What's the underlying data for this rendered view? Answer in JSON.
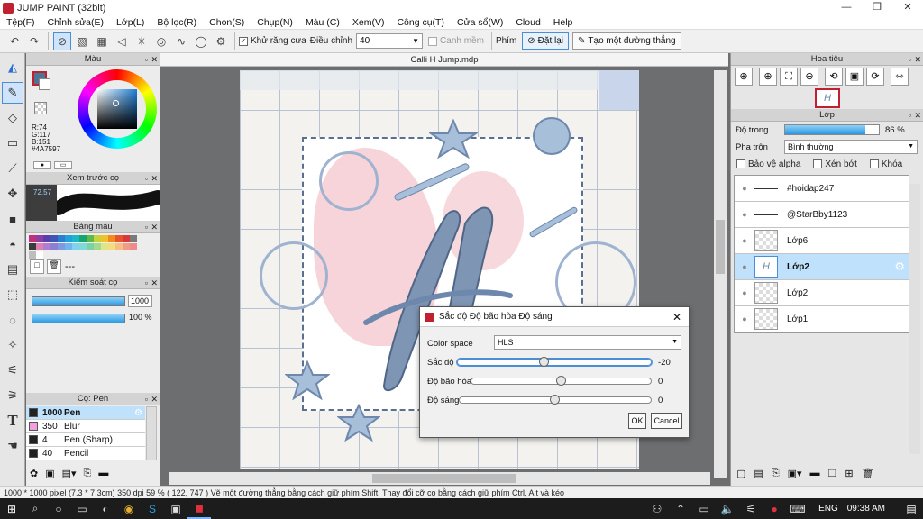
{
  "app": {
    "title": "JUMP PAINT (32bit)",
    "win_min": "—",
    "win_max": "❐",
    "win_close": "✕"
  },
  "menu": [
    "Tệp(F)",
    "Chỉnh sửa(E)",
    "Lớp(L)",
    "Bộ lọc(R)",
    "Chọn(S)",
    "Chụp(N)",
    "Màu (C)",
    "Xem(V)",
    "Công cụ(T)",
    "Cửa sổ(W)",
    "Cloud",
    "Help"
  ],
  "toolbar": {
    "antialias_label": "Khử răng cưa",
    "adjust_label": "Điều chỉnh",
    "adjust_value": "40",
    "snap_label": "Canh mềm",
    "key_label": "Phím",
    "reset_label": "Đặt lại",
    "line_label": "Tạo một đường thẳng"
  },
  "panels": {
    "color": {
      "title": "Màu",
      "r": "R:74",
      "g": "G:117",
      "b": "B:151",
      "hex": "#4A7597",
      "fg": "#4a7597"
    },
    "brush_preview": {
      "title": "Xem trước cọ",
      "pct": "72.57"
    },
    "palette": {
      "title": "Bảng màu",
      "more": "---",
      "swatches": [
        "#c0307c",
        "#8c3fa0",
        "#5b3fae",
        "#3f56b4",
        "#2b7fd1",
        "#22a0d8",
        "#1ab6c9",
        "#1aa36e",
        "#5fb84a",
        "#c6d23c",
        "#f0c22a",
        "#f08c1e",
        "#e8532b",
        "#d63a3a",
        "#7a7a7a",
        "#3b3b3b",
        "#e07fb4",
        "#b07dd0",
        "#8a80d6",
        "#7f9ae0",
        "#6fb6ee",
        "#7fd2f0",
        "#7fd9d6",
        "#7fd0a4",
        "#a4da8c",
        "#dfe68a",
        "#f6dc80",
        "#f6be82",
        "#f29a86",
        "#ee8a8a",
        "#bdbdbd",
        "#ffffff"
      ]
    },
    "brush_control": {
      "title": "Kiểm soát cọ",
      "size_value": "1000",
      "opacity_value": "100 %"
    },
    "brush_list": {
      "title": "Cọ: Pen",
      "items": [
        {
          "size": "1000",
          "name": "Pen",
          "sel": true
        },
        {
          "size": "350",
          "name": "Blur",
          "sel": false
        },
        {
          "size": "4",
          "name": "Pen (Sharp)",
          "sel": false
        },
        {
          "size": "40",
          "name": "Pencil",
          "sel": false
        }
      ]
    }
  },
  "document": {
    "tab": "Calli H Jump.mdp"
  },
  "navigator": {
    "title": "Hoa tiêu"
  },
  "layers": {
    "title": "Lớp",
    "opacity_label": "Độ trong",
    "opacity_value": "86 %",
    "opacity_fraction": 0.86,
    "blend_label": "Pha trộn",
    "blend_value": "Bình thường",
    "protect_alpha": "Bảo vệ alpha",
    "clip": "Xén bớt",
    "lock": "Khóa",
    "items": [
      {
        "name": "#hoidap247",
        "kind": "line",
        "sel": false
      },
      {
        "name": "@StarBby1123",
        "kind": "line",
        "sel": false
      },
      {
        "name": "Lớp6",
        "kind": "thumb",
        "sel": false
      },
      {
        "name": "Lớp2",
        "kind": "thumb",
        "sel": true
      },
      {
        "name": "Lớp2",
        "kind": "thumb",
        "sel": false
      },
      {
        "name": "Lớp1",
        "kind": "thumb",
        "sel": false
      }
    ]
  },
  "dialog": {
    "title": "Sắc độ Độ bão hòa Độ sáng",
    "colorspace_label": "Color space",
    "colorspace_value": "HLS",
    "rows": [
      {
        "label": "Sắc độ",
        "value": "-20",
        "fraction": 0.45
      },
      {
        "label": "Độ bão hòa",
        "value": "0",
        "fraction": 0.5
      },
      {
        "label": "Độ sáng",
        "value": "0",
        "fraction": 0.5
      }
    ],
    "ok": "OK",
    "cancel": "Cancel"
  },
  "status": {
    "text": "1000 * 1000 pixel   (7.3 * 7.3cm)   350 dpi   59 %   ( 122, 747 )   Vẽ một đường thẳng bằng cách giữ phím Shift, Thay đổi cỡ cọ bằng cách giữ phím Ctrl, Alt và kéo"
  },
  "taskbar": {
    "lang": "ENG",
    "time": "09:38 AM"
  }
}
